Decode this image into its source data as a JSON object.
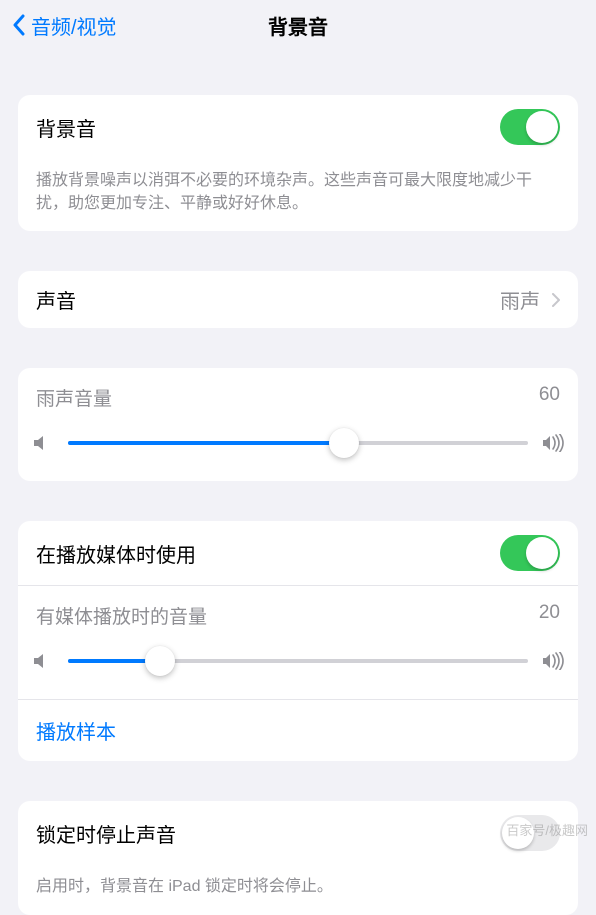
{
  "header": {
    "back_label": "音频/视觉",
    "title": "背景音"
  },
  "sections": {
    "main_toggle": {
      "label": "背景音",
      "on": true,
      "desc": "播放背景噪声以消弭不必要的环境杂声。这些声音可最大限度地减少干扰，助您更加专注、平静或好好休息。"
    },
    "sound": {
      "label": "声音",
      "value": "雨声"
    },
    "rain_volume": {
      "label": "雨声音量",
      "value": "60",
      "percent": 60
    },
    "media": {
      "use_label": "在播放媒体时使用",
      "use_on": true,
      "vol_label": "有媒体播放时的音量",
      "vol_value": "20",
      "vol_percent": 20,
      "sample_label": "播放样本"
    },
    "lock": {
      "label": "锁定时停止声音",
      "on": false,
      "desc": "启用时，背景音在 iPad 锁定时将会停止。"
    }
  },
  "watermark": "百家号/极趣网"
}
